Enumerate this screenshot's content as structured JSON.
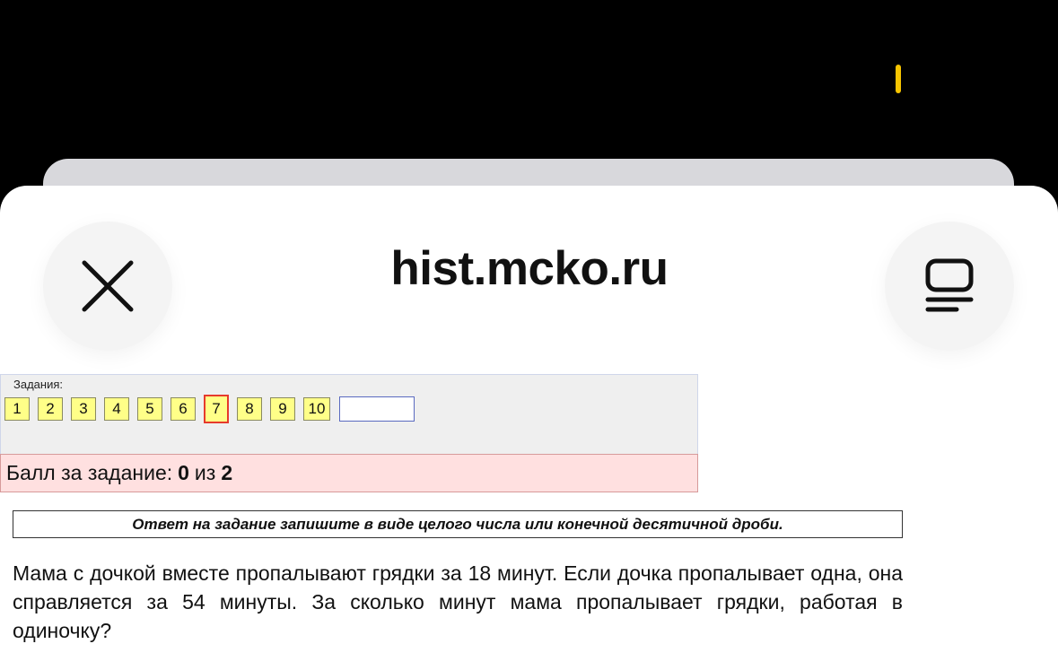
{
  "browser": {
    "title": "hist.mcko.ru",
    "close_icon": "close-icon",
    "menu_icon": "tabs-menu-icon",
    "status_color": "#f6c400"
  },
  "tasks": {
    "label": "Задания:",
    "items": [
      "1",
      "2",
      "3",
      "4",
      "5",
      "6",
      "7",
      "8",
      "9",
      "10"
    ],
    "current": "7"
  },
  "score": {
    "prefix": "Балл за задание:",
    "value": "0",
    "of": "из",
    "max": "2"
  },
  "instruction": "Ответ на задание запишите в виде целого числа или конечной десятичной дроби.",
  "problem_text": "Мама с дочкой вместе пропалывают грядки за 18 минут. Если дочка пропалывает одна, она справляется за 54 минуты. За сколько минут мама пропалывает грядки, работая в одиночку?"
}
